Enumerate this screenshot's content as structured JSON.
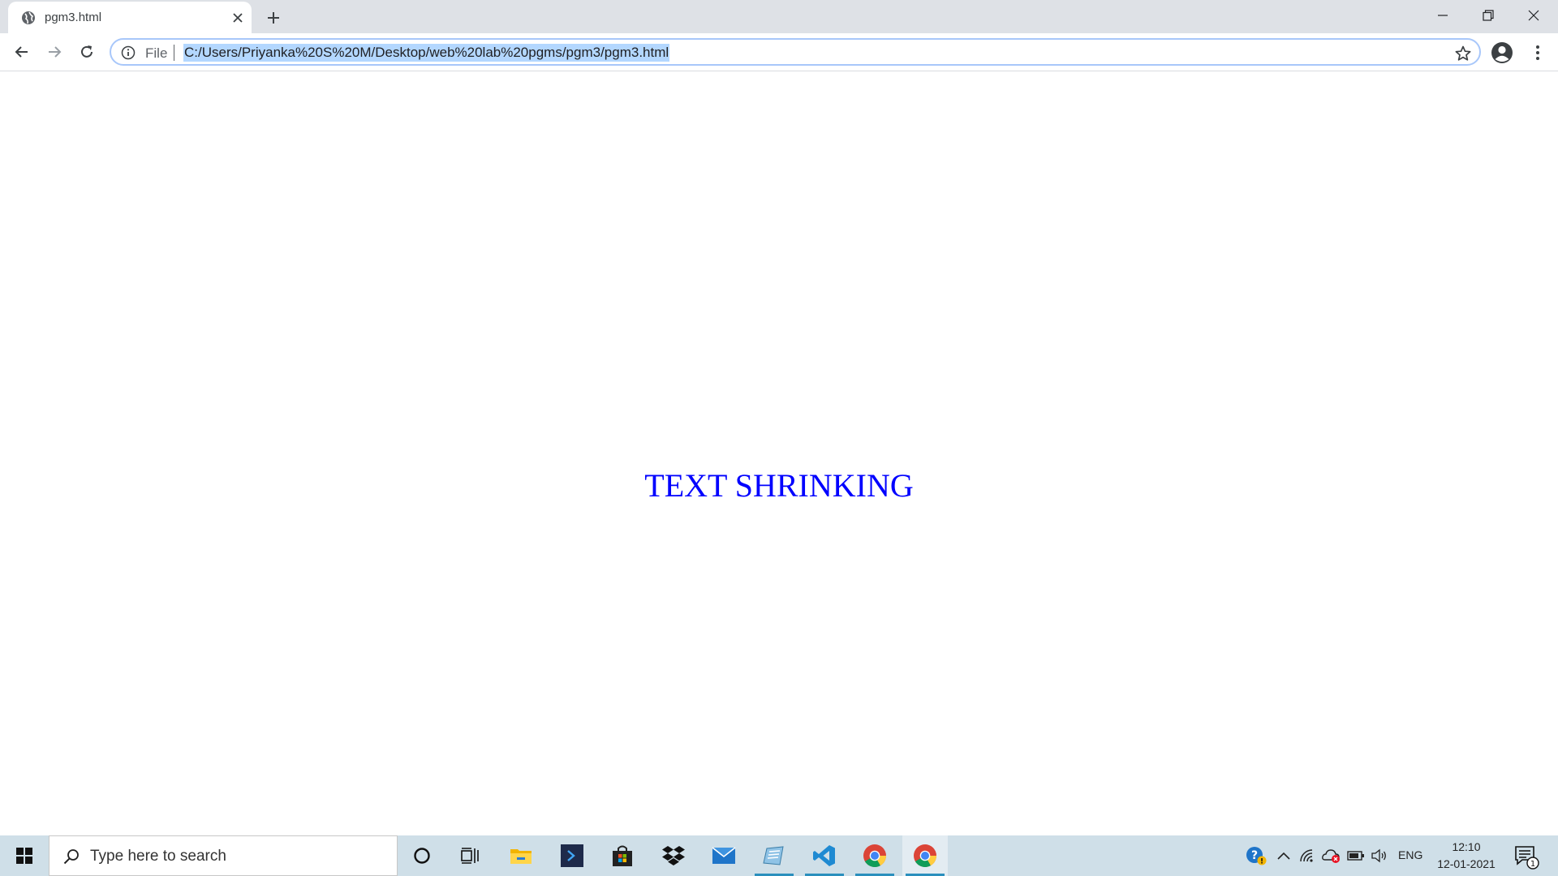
{
  "browser": {
    "tab": {
      "title": "pgm3.html",
      "favicon": "globe-icon",
      "close": "close-icon"
    },
    "new_tab": "plus-icon",
    "window_controls": [
      "minimize-icon",
      "restore-icon",
      "close-icon"
    ],
    "nav": [
      "back-arrow-icon",
      "forward-arrow-icon",
      "reload-icon"
    ],
    "omnibox": {
      "scheme_label": "File",
      "url": "C:/Users/Priyanka%20S%20M/Desktop/web%20lab%20pgms/pgm3/pgm3.html",
      "selection_color": "#b3d7ff"
    }
  },
  "page": {
    "text": "TEXT SHRINKING",
    "text_color": "#0000ff"
  },
  "taskbar": {
    "search_placeholder": "Type here to search",
    "pinned": [
      "cortana-icon",
      "task-view-icon",
      "file-explorer-icon",
      "powershell-icon",
      "store-icon",
      "dropbox-icon",
      "mail-icon",
      "notepad-icon",
      "vscode-icon",
      "chrome-icon",
      "chrome-icon"
    ],
    "tray": {
      "language": "ENG",
      "time": "12:10",
      "date": "12-01-2021",
      "notification_count": "1"
    }
  }
}
